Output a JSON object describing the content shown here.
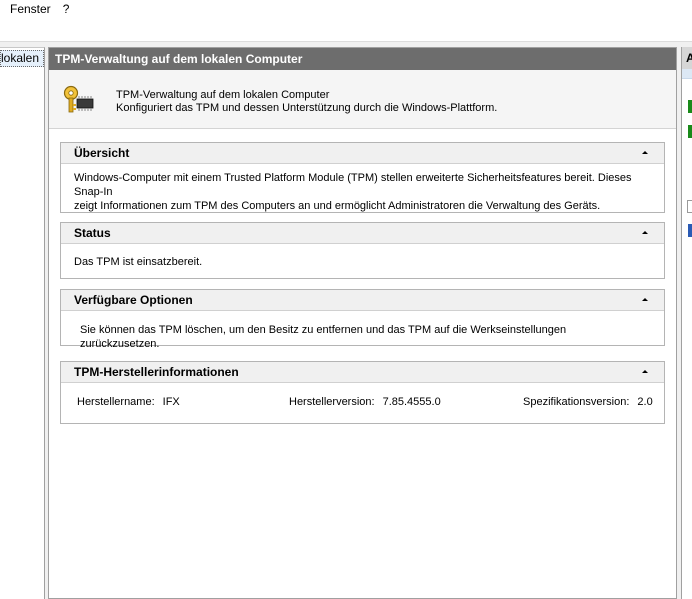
{
  "menu": {
    "items": [
      "Fenster",
      "?"
    ]
  },
  "tree": {
    "selected_label": "lokalen Computer"
  },
  "center": {
    "title": "TPM-Verwaltung auf dem lokalen Computer",
    "header_line1": "TPM-Verwaltung auf dem lokalen Computer",
    "header_line2": "Konfiguriert das TPM und dessen Unterstützung durch die Windows-Plattform.",
    "header_icon": "tpm-key-chip-icon"
  },
  "sections": {
    "overview": {
      "title": "Übersicht",
      "text_line1": "Windows-Computer mit einem Trusted Platform Module (TPM) stellen erweiterte Sicherheitsfeatures bereit. Dieses Snap-In",
      "text_line2": "zeigt Informationen zum TPM des Computers an und ermöglicht Administratoren die Verwaltung des Geräts."
    },
    "status": {
      "title": "Status",
      "text": "Das TPM ist einsatzbereit."
    },
    "options": {
      "title": "Verfügbare Optionen",
      "text": "Sie können das TPM löschen, um den Besitz zu entfernen und das TPM auf die Werkseinstellungen zurückzusetzen."
    },
    "manufacturer": {
      "title": "TPM-Herstellerinformationen",
      "name_label": "Herstellername:",
      "name_value": "IFX",
      "version_label": "Herstellerversion:",
      "version_value": "7.85.4555.0",
      "spec_label": "Spezifikationsversion:",
      "spec_value": "2.0"
    }
  },
  "actions": {
    "header": "A"
  },
  "colors": {
    "title_bar": "#6d6d6d",
    "action_green": "#1a8a1a",
    "action_blue": "#2b5bb5"
  }
}
